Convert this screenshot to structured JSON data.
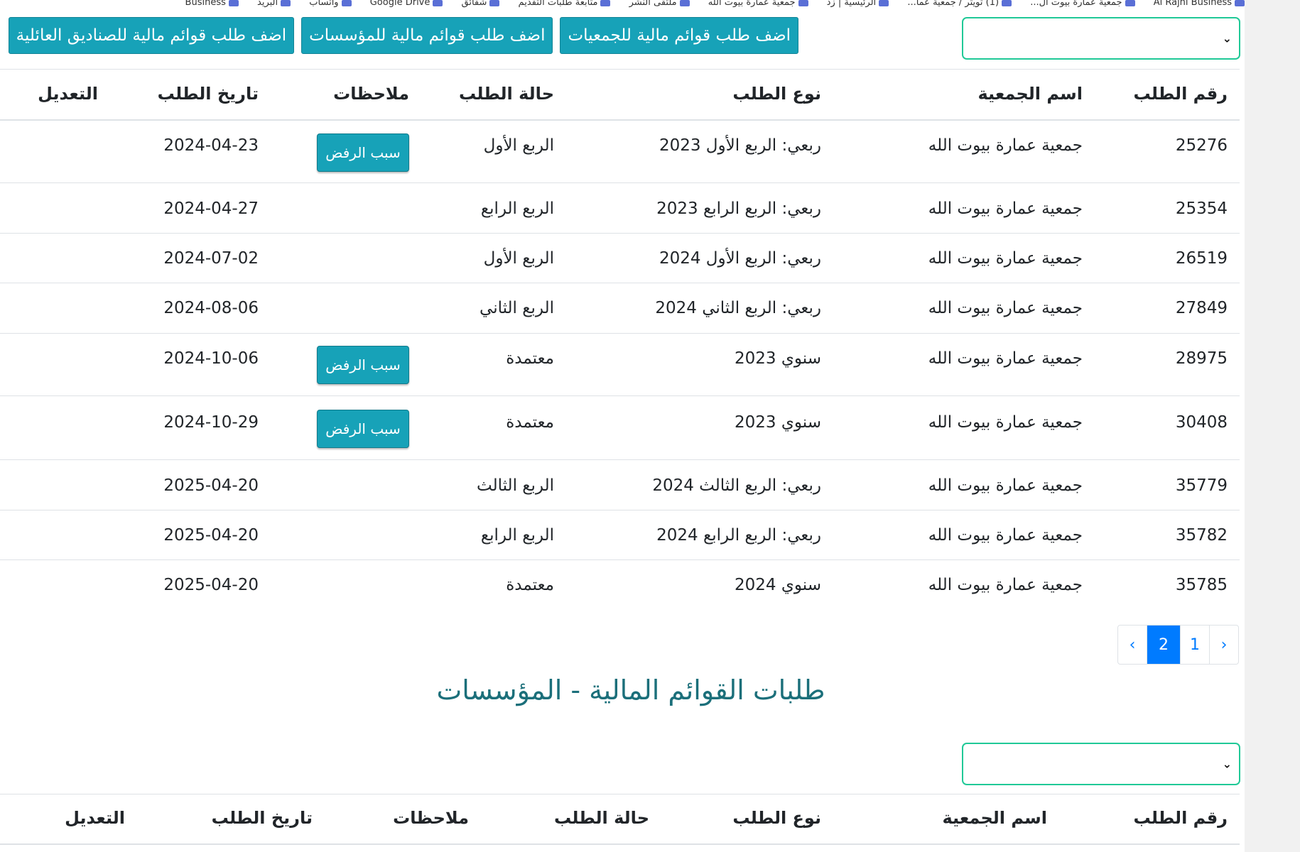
{
  "bookmarks": [
    "Al Rajhi Business",
    "جمعية عمارة بيوت ال...",
    "(1) تويتر / جمعية عما...",
    "الرئيسية | زد",
    "جمعية عمارة بيوت الله",
    "ملتقى النشر",
    "متابعة طلبات التقديم",
    "شقائق",
    "Google Drive",
    "واتساب",
    "البريد",
    "Business"
  ],
  "buttons": {
    "add_associations": "اضف طلب قوائم مالية للجمعيات",
    "add_institutions": "اضف طلب قوائم مالية للمؤسسات",
    "add_family_funds": "اضف طلب قوائم مالية للصناديق العائلية",
    "reject_reason": "سبب الرفض"
  },
  "headers": {
    "request_no": "رقم الطلب",
    "association_name": "اسم الجمعية",
    "request_type": "نوع الطلب",
    "request_status": "حالة الطلب",
    "notes": "ملاحظات",
    "request_date": "تاريخ الطلب",
    "edit": "التعديل"
  },
  "rows": [
    {
      "no": "25276",
      "name": "جمعية عمارة بيوت الله",
      "type": "ربعي: الربع الأول 2023",
      "status": "الربع الأول",
      "date": "2024-04-23",
      "reject": true
    },
    {
      "no": "25354",
      "name": "جمعية عمارة بيوت الله",
      "type": "ربعي: الربع الرابع 2023",
      "status": "الربع الرابع",
      "date": "2024-04-27",
      "reject": false
    },
    {
      "no": "26519",
      "name": "جمعية عمارة بيوت الله",
      "type": "ربعي: الربع الأول 2024",
      "status": "الربع الأول",
      "date": "2024-07-02",
      "reject": false
    },
    {
      "no": "27849",
      "name": "جمعية عمارة بيوت الله",
      "type": "ربعي: الربع الثاني 2024",
      "status": "الربع الثاني",
      "date": "2024-08-06",
      "reject": false
    },
    {
      "no": "28975",
      "name": "جمعية عمارة بيوت الله",
      "type": "سنوي 2023",
      "status": "معتمدة",
      "date": "2024-10-06",
      "reject": true
    },
    {
      "no": "30408",
      "name": "جمعية عمارة بيوت الله",
      "type": "سنوي 2023",
      "status": "معتمدة",
      "date": "2024-10-29",
      "reject": true
    },
    {
      "no": "35779",
      "name": "جمعية عمارة بيوت الله",
      "type": "ربعي: الربع الثالث 2024",
      "status": "الربع الثالث",
      "date": "2025-04-20",
      "reject": false
    },
    {
      "no": "35782",
      "name": "جمعية عمارة بيوت الله",
      "type": "ربعي: الربع الرابع 2024",
      "status": "الربع الرابع",
      "date": "2025-04-20",
      "reject": false
    },
    {
      "no": "35785",
      "name": "جمعية عمارة بيوت الله",
      "type": "سنوي 2024",
      "status": "معتمدة",
      "date": "2025-04-20",
      "reject": false
    }
  ],
  "pagination": {
    "prev": "‹",
    "page2": "2",
    "page1": "1",
    "next": "›"
  },
  "section_title": "طلبات القوائم المالية - المؤسسات"
}
